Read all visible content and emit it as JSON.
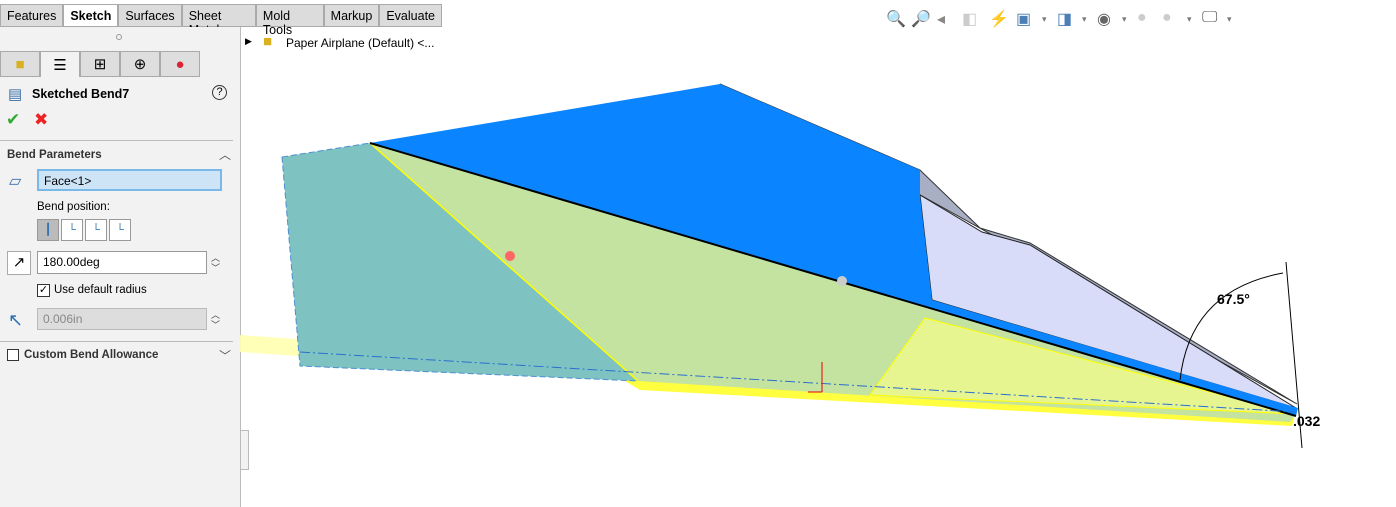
{
  "tabs": [
    "Features",
    "Sketch",
    "Surfaces",
    "Sheet Metal",
    "Mold Tools",
    "Markup",
    "Evaluate"
  ],
  "active_tab": "Sketch",
  "tree": {
    "root": "Paper Airplane (Default) <..."
  },
  "property_manager": {
    "title": "Sketched Bend7",
    "section": "Bend Parameters",
    "face_value": "Face<1>",
    "bend_position_label": "Bend position:",
    "angle_value": "180.00deg",
    "use_default_radius_label": "Use default radius",
    "use_default_radius_checked": true,
    "radius_value": "0.006in",
    "custom_bend_allowance_label": "Custom Bend Allowance",
    "custom_bend_allowance_checked": false
  },
  "toolbar_icons": [
    "zoom-to-fit-icon",
    "zoom-to-area-icon",
    "previous-view-icon",
    "section-view-icon",
    "dynamic-annotation-icon",
    "view-orientation-icon",
    "display-style-icon",
    "hide-show-icon",
    "edit-appearance-icon",
    "apply-scene-icon",
    "view-settings-icon"
  ],
  "dimensions": {
    "angle": "67.5°",
    "thickness": ".032"
  },
  "colors": {
    "face_blue": "#0a84ff",
    "teal": "#7fc2c2",
    "yellow": "#ffff60"
  }
}
